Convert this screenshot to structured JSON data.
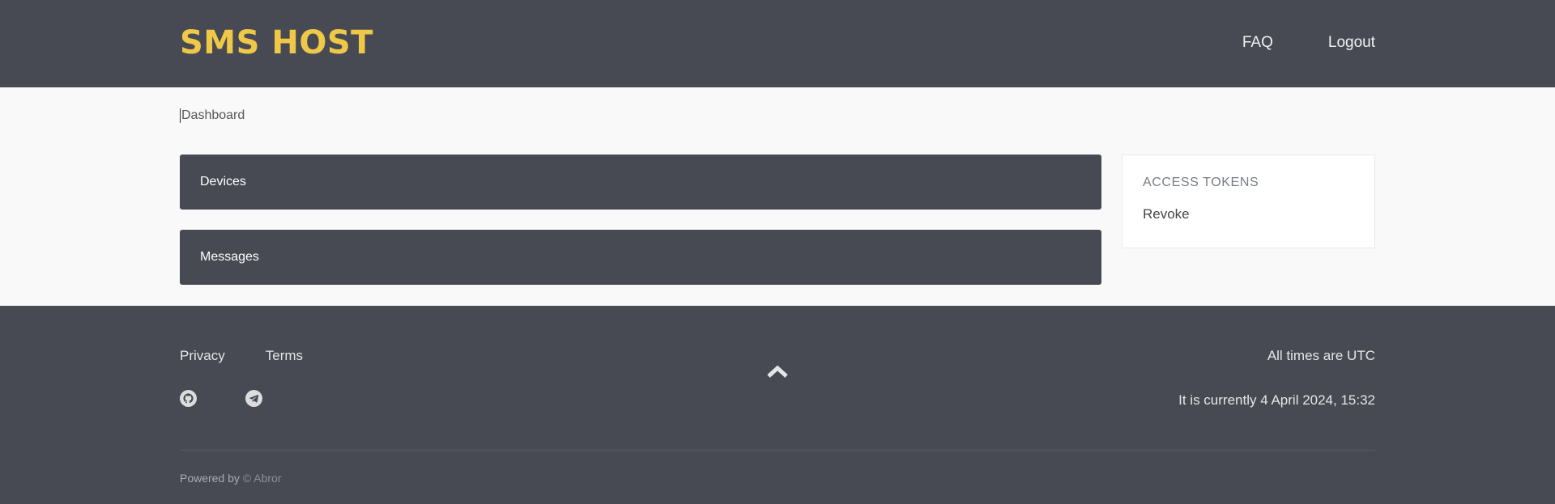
{
  "header": {
    "logo": "SMS HOST",
    "nav": [
      "FAQ",
      "Logout"
    ]
  },
  "breadcrumb": "Dashboard",
  "panels": {
    "devices": "Devices",
    "messages": "Messages"
  },
  "tokens": {
    "title": "ACCESS TOKENS",
    "revoke": "Revoke"
  },
  "footer": {
    "links": [
      "Privacy",
      "Terms"
    ],
    "icons": [
      "github-icon",
      "telegram-icon",
      "chevron-up-icon"
    ],
    "timezone": "All times are UTC",
    "current_time": "It is currently 4 April 2024, 15:32",
    "powered_prefix": "Powered by",
    "powered_author": "© Abror"
  },
  "colors": {
    "dark": "#474a53",
    "accent": "#efc848",
    "light_bg": "#f9f9f9"
  }
}
